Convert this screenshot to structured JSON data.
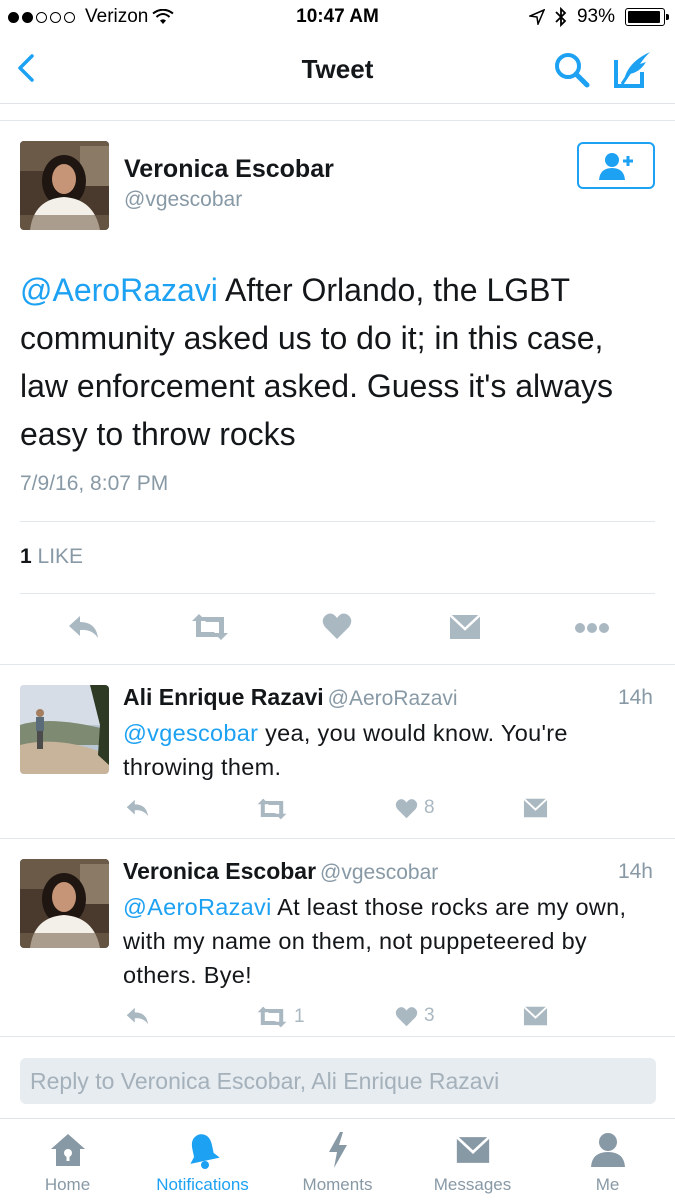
{
  "status_bar": {
    "carrier": "Verizon",
    "time": "10:47 AM",
    "battery": "93%",
    "battery_level": 0.93
  },
  "nav": {
    "title": "Tweet"
  },
  "main_tweet": {
    "name": "Veronica Escobar",
    "handle": "@vgescobar",
    "mention": "@AeroRazavi",
    "text": " After Orlando, the LGBT community asked us to do it; in this case, law enforcement asked.  Guess it's always easy to throw rocks",
    "timestamp": "7/9/16, 8:07 PM",
    "like_count": "1",
    "like_label": "LIKE"
  },
  "replies": [
    {
      "name": "Ali Enrique Razavi",
      "handle": "@AeroRazavi",
      "time": "14h",
      "mention": "@vgescobar",
      "text": " yea, you would know. You're throwing them.",
      "retweets": "",
      "likes": "8"
    },
    {
      "name": "Veronica Escobar",
      "handle": "@vgescobar",
      "time": "14h",
      "mention": "@AeroRazavi",
      "text": " At least those rocks are my own, with my name on them, not puppeteered by others.  Bye!",
      "retweets": "1",
      "likes": "3"
    }
  ],
  "reply_box": {
    "placeholder": "Reply to Veronica Escobar, Ali Enrique Razavi"
  },
  "tabs": [
    {
      "label": "Home",
      "icon": "home-icon"
    },
    {
      "label": "Notifications",
      "icon": "bell-icon"
    },
    {
      "label": "Moments",
      "icon": "lightning-icon"
    },
    {
      "label": "Messages",
      "icon": "envelope-icon"
    },
    {
      "label": "Me",
      "icon": "person-icon"
    }
  ],
  "colors": {
    "accent": "#1da1f2",
    "muted": "#8899a6",
    "icon_gray": "#aab8c2"
  }
}
